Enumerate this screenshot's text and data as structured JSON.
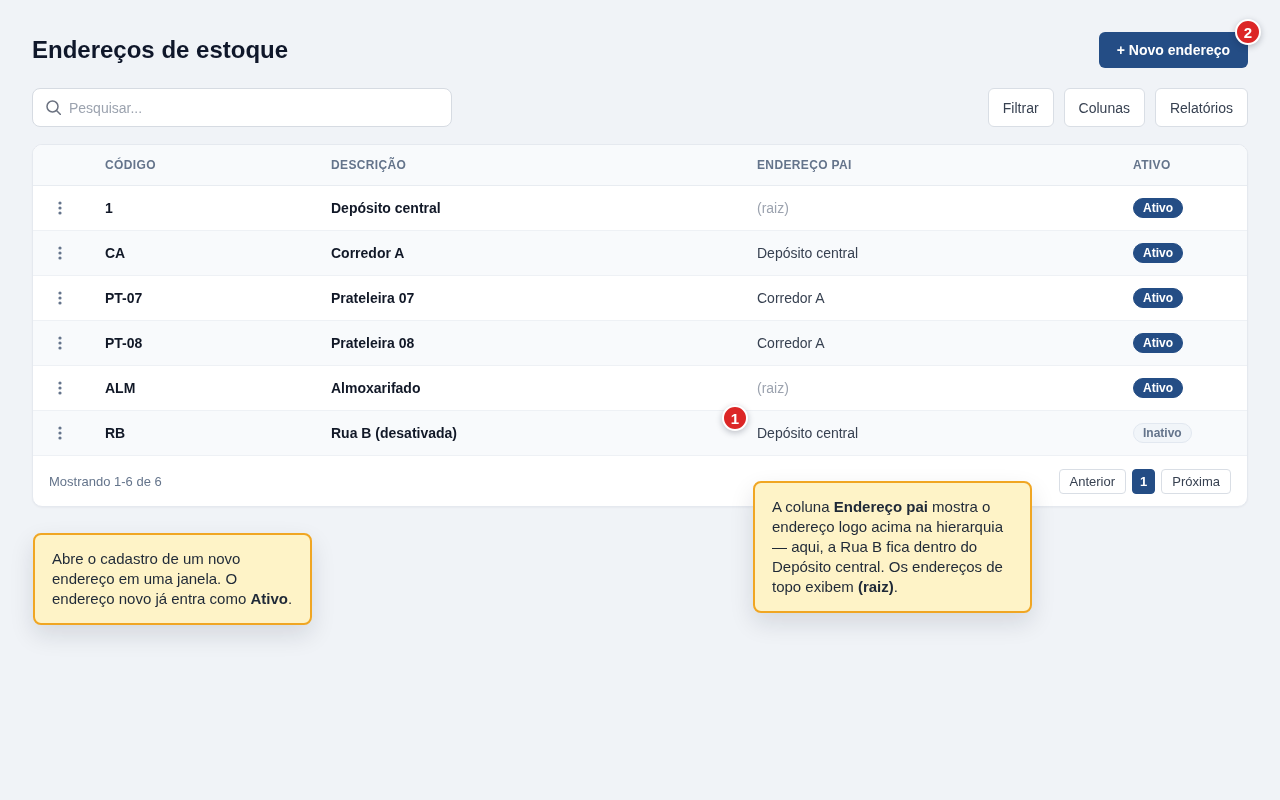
{
  "page": {
    "title": "Endereços de estoque",
    "new_button": "+ Novo endereço"
  },
  "toolbar": {
    "search": {
      "placeholder": "Pesquisar..."
    },
    "buttons": [
      "Filtrar",
      "Colunas",
      "Relatórios"
    ]
  },
  "table": {
    "columns": [
      "CÓDIGO",
      "DESCRIÇÃO",
      "ENDEREÇO PAI",
      "ATIVO"
    ],
    "rows": [
      {
        "code": "1",
        "description": "Depósito central",
        "parent": "(raiz)",
        "root": true,
        "status": {
          "label": "Ativo",
          "active": true
        }
      },
      {
        "code": "CA",
        "description": "Corredor A",
        "parent": "Depósito central",
        "root": false,
        "status": {
          "label": "Ativo",
          "active": true
        }
      },
      {
        "code": "PT-07",
        "description": "Prateleira 07",
        "parent": "Corredor A",
        "root": false,
        "status": {
          "label": "Ativo",
          "active": true
        }
      },
      {
        "code": "PT-08",
        "description": "Prateleira 08",
        "parent": "Corredor A",
        "root": false,
        "status": {
          "label": "Ativo",
          "active": true
        }
      },
      {
        "code": "ALM",
        "description": "Almoxarifado",
        "parent": "(raiz)",
        "root": true,
        "status": {
          "label": "Ativo",
          "active": true
        }
      },
      {
        "code": "RB",
        "description": "Rua B (desativada)",
        "parent": "Depósito central",
        "root": false,
        "status": {
          "label": "Inativo",
          "active": false
        }
      }
    ]
  },
  "footer": {
    "summary": "Mostrando 1-6 de 6",
    "pagination": {
      "previous": "Anterior",
      "pages": [
        {
          "label": "1",
          "selected": true
        }
      ],
      "next": "Próxima"
    }
  },
  "annotations": [
    {
      "marker": "1",
      "text": "A coluna **Endereço pai** mostra o endereço logo acima na hierarquia — aqui, a Rua B fica dentro do Depósito central. Os endereços de topo exibem **(raiz)**."
    },
    {
      "marker": "2",
      "text": "Abre o cadastro de um novo endereço em uma janela. O endereço novo já entra como **Ativo**."
    }
  ]
}
